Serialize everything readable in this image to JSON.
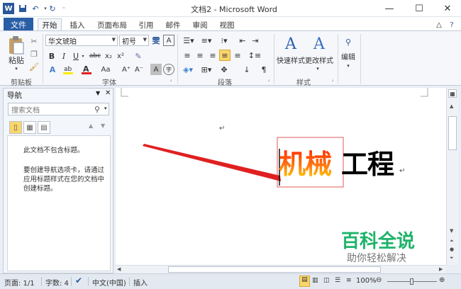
{
  "titlebar": {
    "title": "文档2 - Microsoft Word",
    "app_icon": "word-icon",
    "quick_access": [
      "save-icon",
      "undo-icon",
      "redo-icon",
      "customize-icon"
    ]
  },
  "tabs": {
    "file": "文件",
    "items": [
      "开始",
      "插入",
      "页面布局",
      "引用",
      "邮件",
      "审阅",
      "视图"
    ],
    "active": "开始"
  },
  "ribbon": {
    "clipboard": {
      "label": "剪贴板",
      "paste": "粘贴"
    },
    "font": {
      "label": "字体",
      "font_name": "华文琥珀",
      "font_size": "初号",
      "wen": "雯",
      "bold": "B",
      "italic": "I",
      "underline": "U",
      "strike": "abc",
      "sub": "x₂",
      "sup": "x²",
      "grow": "A⁺",
      "shrink": "A⁻",
      "aa": "Aa",
      "a_char": "A",
      "circle_char": "字"
    },
    "paragraph": {
      "label": "段落"
    },
    "styles": {
      "label": "样式",
      "quick_styles": "快速样式",
      "change_styles": "更改样式"
    },
    "editing": {
      "label": "编辑"
    }
  },
  "nav_pane": {
    "title": "导航",
    "search_placeholder": "搜索文档",
    "no_headings": "此文档不包含标题。",
    "hint_lines": [
      "要创建导航选项卡，请通过",
      "应用标题样式在您的文档中",
      "创建标题。"
    ]
  },
  "document": {
    "paragraph_mark": "↵",
    "word_part1": "机械",
    "word_part2": "工程",
    "colors": {
      "gradient_top": "#ff2a00",
      "gradient_bottom": "#ffd400",
      "black": "#000000",
      "arrow": "#e02020",
      "selection_box": "#e05a5a"
    }
  },
  "watermark": {
    "title": "百科全说",
    "subtitle": "助你轻松解决",
    "color": "#1eb36a"
  },
  "statusbar": {
    "page": "页面: 1/1",
    "words": "字数: 4",
    "language": "中文(中国)",
    "insert_mode": "插入",
    "zoom": "100%"
  }
}
